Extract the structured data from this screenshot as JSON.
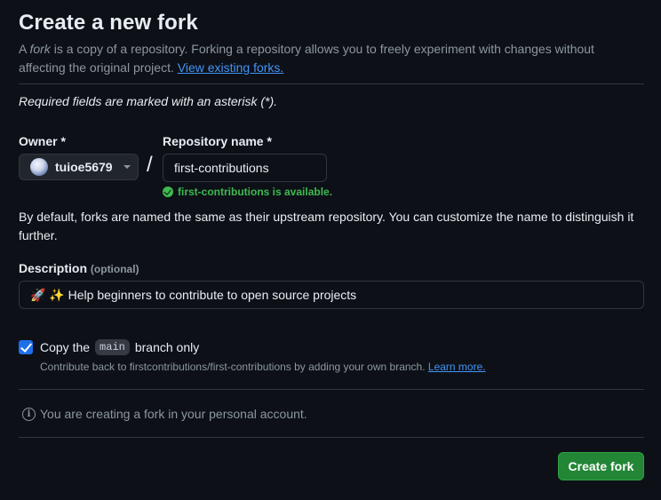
{
  "header": {
    "title": "Create a new fork",
    "subtitle_prefix": "A ",
    "subtitle_em": "fork",
    "subtitle_rest": " is a copy of a repository. Forking a repository allows you to freely experiment with changes without affecting the original project.",
    "view_forks_link": "View existing forks."
  },
  "form": {
    "required_note": "Required fields are marked with an asterisk (*).",
    "owner_label": "Owner *",
    "owner_value": "tuioe5679",
    "slash": "/",
    "repo_label": "Repository name *",
    "repo_value": "first-contributions",
    "availability": "first-contributions is available.",
    "naming_info": "By default, forks are named the same as their upstream repository. You can customize the name to distinguish it further.",
    "description_label": "Description",
    "description_optional": "(optional)",
    "description_value": "🚀 ✨ Help beginners to contribute to open source projects",
    "copy_checked": true,
    "copy_label_before": "Copy the",
    "copy_branch": "main",
    "copy_label_after": "branch only",
    "copy_help": "Contribute back to firstcontributions/first-contributions by adding your own branch.",
    "learn_more_link": "Learn more.",
    "personal_note": "You are creating a fork in your personal account.",
    "create_button": "Create fork"
  },
  "colors": {
    "background": "#0d1117",
    "link": "#4493f8",
    "success": "#3fb950",
    "primary_button": "#238636",
    "checkbox": "#1f6feb"
  },
  "icons": {
    "availability": "check-circle-fill-icon",
    "owner_dropdown": "triangle-down-icon",
    "note": "info-icon"
  }
}
